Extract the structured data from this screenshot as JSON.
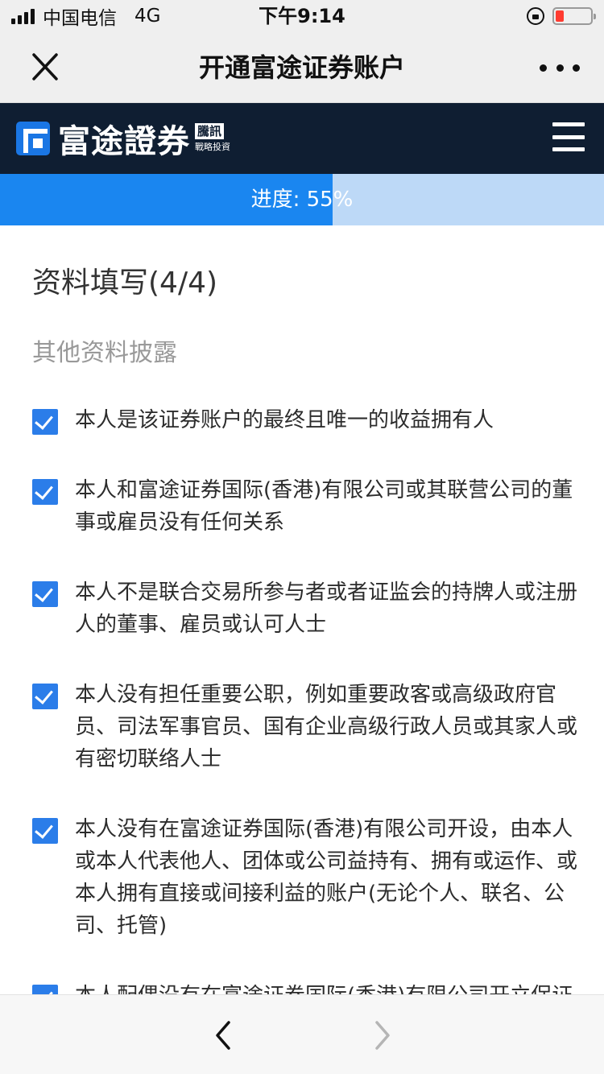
{
  "status_bar": {
    "carrier": "中国电信",
    "network": "4G",
    "time": "下午9:14",
    "icons": [
      "signal-icon",
      "orientation-lock-icon",
      "battery-icon"
    ]
  },
  "nav": {
    "title": "开通富途证券账户",
    "icons": [
      "close-icon",
      "more-icon"
    ]
  },
  "brand": {
    "name": "富途證券",
    "partner_tag": "騰訊",
    "partner_sub": "戰略投資",
    "icons": [
      "futu-logo-icon",
      "menu-icon"
    ],
    "colors": {
      "header_bg": "#0f1e32",
      "brand_blue": "#1a76e4"
    }
  },
  "progress": {
    "label": "进度: 55%",
    "value": 0.55,
    "colors": {
      "fill": "#1a86f0",
      "track": "#bdd9f7"
    }
  },
  "form": {
    "title": "资料填写(4/4)",
    "subtitle": "其他资料披露",
    "items": [
      {
        "checked": true,
        "text": "本人是该证券账户的最终且唯一的收益拥有人"
      },
      {
        "checked": true,
        "text": "本人和富途证券国际(香港)有限公司或其联营公司的董事或雇员没有任何关系"
      },
      {
        "checked": true,
        "text": "本人不是联合交易所参与者或者证监会的持牌人或注册人的董事、雇员或认可人士"
      },
      {
        "checked": true,
        "text": "本人没有担任重要公职，例如重要政客或高级政府官员、司法军事官员、国有企业高级行政人员或其家人或有密切联络人士"
      },
      {
        "checked": true,
        "text": "本人没有在富途证券国际(香港)有限公司开设，由本人或本人代表他人、团体或公司益持有、拥有或运作、或本人拥有直接或间接利益的账户(无论个人、联名、公司、托管)"
      },
      {
        "checked": true,
        "text": "本人配偶没有在富途证券国际(香港)有限公司开立保证金账户"
      }
    ],
    "colors": {
      "checkbox": "#2b7de9"
    }
  },
  "bottom_nav": {
    "icons": [
      "back-arrow-icon",
      "forward-arrow-icon"
    ]
  }
}
